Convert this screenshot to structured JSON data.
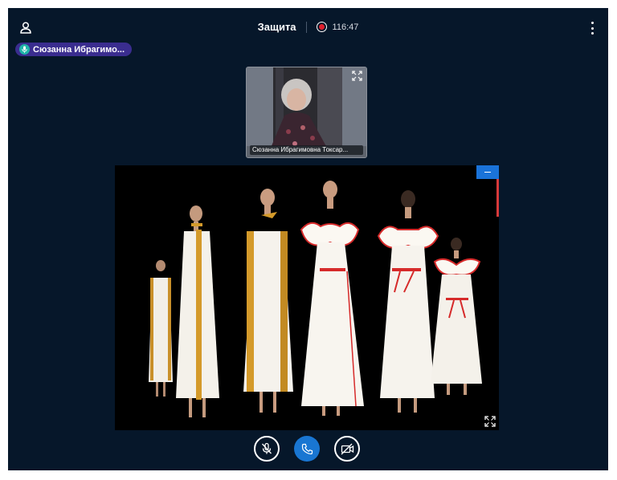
{
  "header": {
    "title": "Защита",
    "recording_time": "116:47"
  },
  "talking_indicator": {
    "name": "Сюзанна Ибрагимо..."
  },
  "webcam": {
    "participant_name": "Сюзанна Ибрагимовна Токсар..."
  },
  "screenshare": {
    "content": "presentation slide: photo of five models in white dresses"
  },
  "icons": {
    "users": "user-icon",
    "record": "record-icon",
    "menu": "more-vertical-icon",
    "mic": "microphone-muted-icon",
    "phone": "phone-icon",
    "camera": "video-off-icon",
    "expand": "fullscreen-icon",
    "minimize": "minimize-icon"
  },
  "colors": {
    "background": "#06172a",
    "accent": "#1976d2",
    "talker_badge": "#3a2d8f",
    "record": "#e01f2d"
  }
}
